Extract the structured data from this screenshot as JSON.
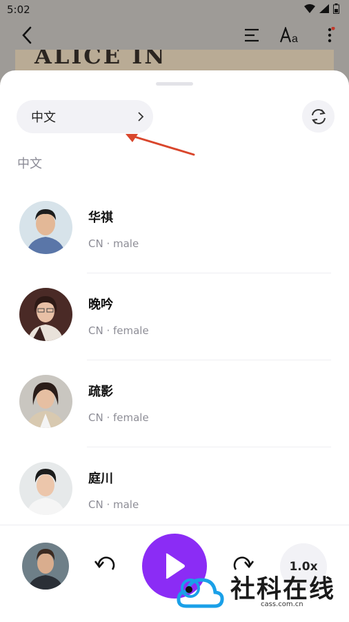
{
  "status": {
    "time": "5:02"
  },
  "book": {
    "banner_text": "ALICE IN WONDERLAND"
  },
  "sheet": {
    "language_selector": "中文",
    "section_title": "中文",
    "voices": [
      {
        "name": "华祺",
        "meta": "CN · male",
        "gender": "male"
      },
      {
        "name": "晚吟",
        "meta": "CN · female",
        "gender": "female"
      },
      {
        "name": "疏影",
        "meta": "CN · female",
        "gender": "female"
      },
      {
        "name": "庭川",
        "meta": "CN · male",
        "gender": "male"
      }
    ]
  },
  "player": {
    "speed": "1.0x"
  },
  "watermark": {
    "title": "社科在线",
    "sub": "cass.com.cn"
  },
  "colors": {
    "accent": "#8b2cf5",
    "annotation_arrow": "#d9462c"
  },
  "icons": [
    "back-arrow-icon",
    "list-icon",
    "font-size-icon",
    "more-vertical-icon",
    "chevron-right-icon",
    "refresh-icon",
    "rewind-icon",
    "play-icon",
    "forward-icon"
  ]
}
